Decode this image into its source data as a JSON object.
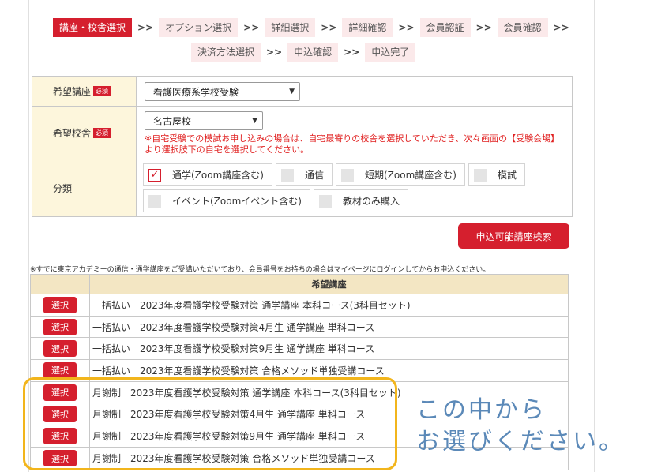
{
  "steps": [
    {
      "label": "講座・校舎選択",
      "active": true
    },
    {
      "label": "オプション選択"
    },
    {
      "label": "詳細選択"
    },
    {
      "label": "詳細確認"
    },
    {
      "label": "会員認証"
    },
    {
      "label": "会員確認"
    },
    {
      "label": "決済方法選択"
    },
    {
      "label": "申込確認"
    },
    {
      "label": "申込完了"
    }
  ],
  "step_separator": ">>",
  "form": {
    "course_label": "希望講座",
    "course_value": "看護医療系学校受験",
    "required_badge": "必須",
    "school_label": "希望校舎",
    "school_value": "名古屋校",
    "school_note": "※自宅受験での模試お申し込みの場合は、自宅最寄りの校舎を選択していただき、次々画面の【受験会場】より選択肢下の自宅を選択してください。",
    "category_label": "分類",
    "categories": [
      {
        "label": "通学(Zoom講座含む)",
        "checked": true
      },
      {
        "label": "通信",
        "checked": false
      },
      {
        "label": "短期(Zoom講座含む)",
        "checked": false
      },
      {
        "label": "模試",
        "checked": false
      },
      {
        "label": "イベント(Zoomイベント含む)",
        "checked": false
      },
      {
        "label": "教材のみ購入",
        "checked": false
      }
    ]
  },
  "search_button": "申込可能講座検索",
  "notice": "※すでに東京アカデミーの通信・通学講座をご受講いただいており、会員番号をお持ちの場合はマイページにログインしてからお申込ください。",
  "courses": {
    "header": "希望講座",
    "select_label": "選択",
    "rows": [
      "一括払い　2023年度看護学校受験対策 通学講座 本科コース(3科目セット)",
      "一括払い　2023年度看護学校受験対策4月生 通学講座 単科コース",
      "一括払い　2023年度看護学校受験対策9月生 通学講座 単科コース",
      "一括払い　2023年度看護学校受験対策 合格メソッド単独受講コース",
      "月謝制　2023年度看護学校受験対策 通学講座 本科コース(3科目セット)",
      "月謝制　2023年度看護学校受験対策4月生 通学講座 単科コース",
      "月謝制　2023年度看護学校受験対策9月生 通学講座 単科コース",
      "月謝制　2023年度看護学校受験対策 合格メソッド単独受講コース"
    ]
  },
  "annotation": {
    "line1": "この中から",
    "line2": "お選びください。"
  },
  "colors": {
    "accent": "#d51f2e",
    "step_bg": "#fbe9ea",
    "header_bg": "#fdf6dc",
    "highlight": "#f2b51c",
    "annotation": "#5b89b8"
  }
}
